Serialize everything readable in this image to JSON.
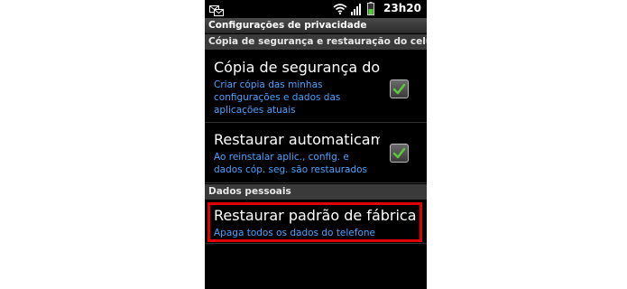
{
  "status_bar": {
    "time": "23h20",
    "icons": [
      "messages-icon",
      "wifi-icon",
      "signal-icon",
      "battery-icon"
    ]
  },
  "title": "Configurações de privacidade",
  "sections": [
    {
      "header": "Cópia de segurança e restauração do celular"
    },
    {
      "header": "Dados pessoais"
    }
  ],
  "items": {
    "backup": {
      "title": "Cópia de segurança dos",
      "subtitle": "Criar cópia das minhas configurações e dados das aplicações atuais",
      "checked": true
    },
    "auto_restore": {
      "title": "Restaurar automaticame",
      "subtitle": "Ao reinstalar aplic., config. e dados cóp. seg. são restaurados",
      "checked": true
    },
    "factory_reset": {
      "title": "Restaurar padrão de fábrica",
      "subtitle": "Apaga todos os dados do telefone"
    }
  },
  "colors": {
    "background": "#000000",
    "subtitle": "#4aa3ff",
    "check": "#5ac83a",
    "highlight": "#e30000"
  }
}
